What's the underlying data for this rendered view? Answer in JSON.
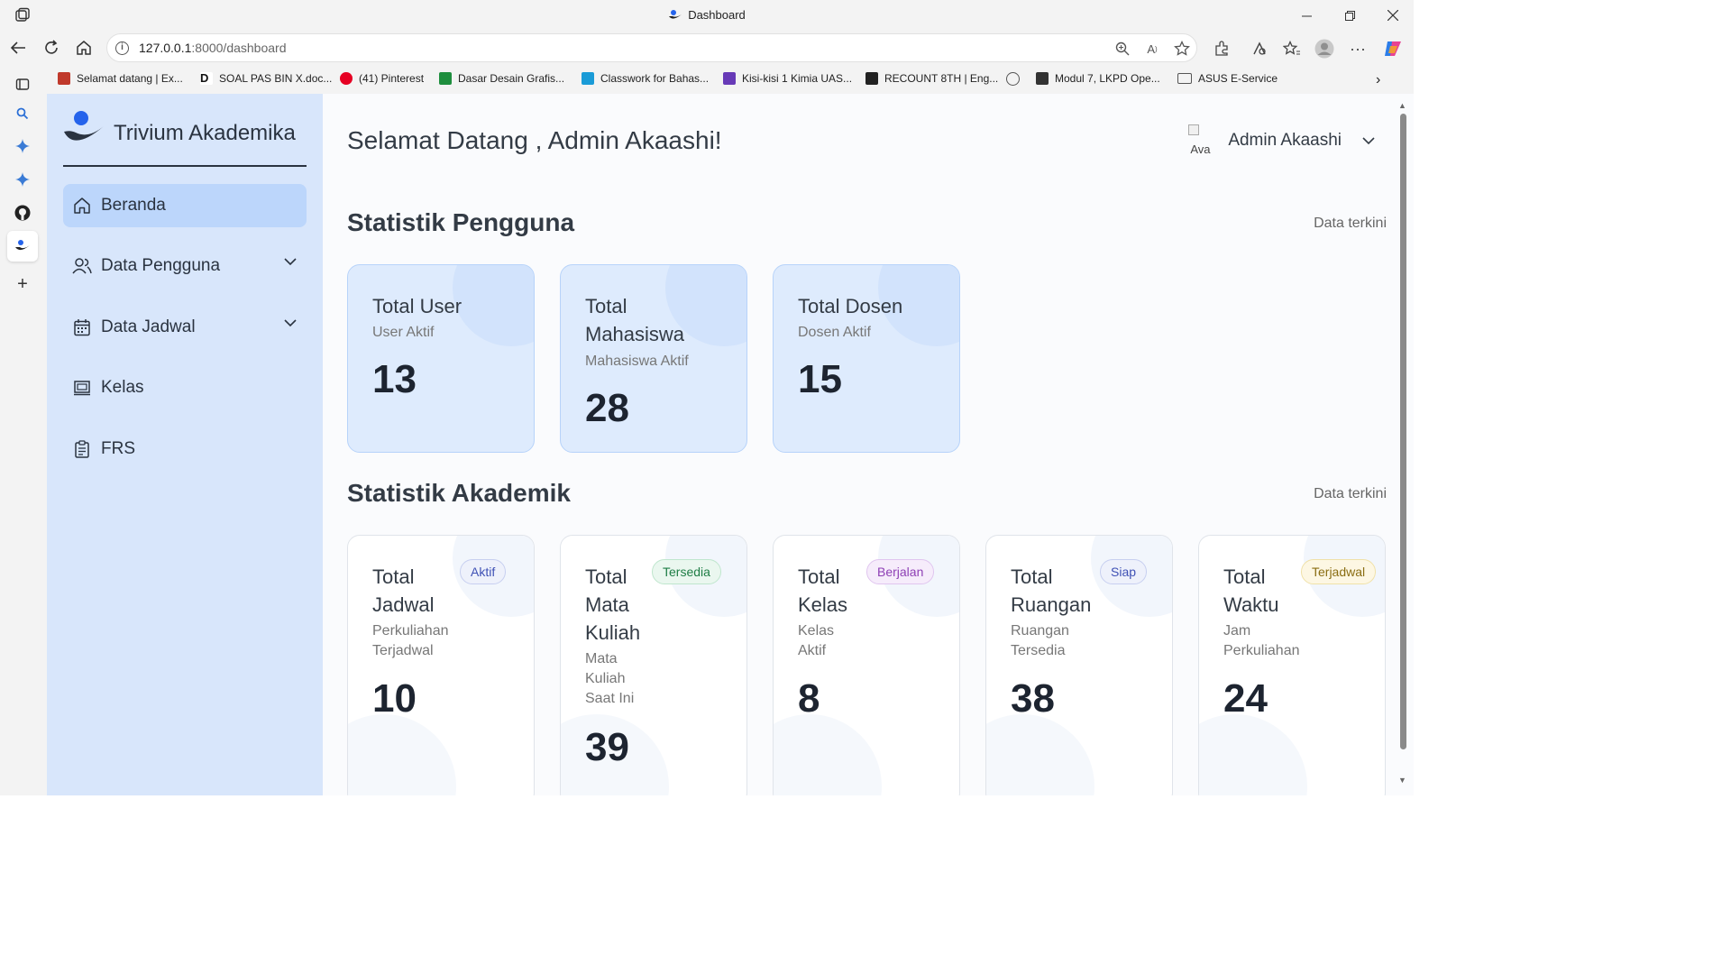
{
  "window": {
    "title": "Dashboard",
    "controls": [
      "minimize",
      "restore",
      "close"
    ]
  },
  "address": {
    "url_host": "127.0.0.1",
    "url_rest": ":8000/dashboard"
  },
  "bookmarks": [
    {
      "label": "Selamat datang | Ex...",
      "color": "#c0392b"
    },
    {
      "label": "SOAL PAS BIN X.doc...",
      "color": "#111111"
    },
    {
      "label": "(41) Pinterest",
      "color": "#e60023"
    },
    {
      "label": "Dasar Desain Grafis...",
      "color": "#1e8e3e"
    },
    {
      "label": "Classwork for Bahas...",
      "color": "#1a9bd7"
    },
    {
      "label": "Kisi-kisi 1 Kimia UAS...",
      "color": "#673ab7"
    },
    {
      "label": "RECOUNT 8TH | Eng...",
      "color": "#222222"
    },
    {
      "label": "",
      "color": "#555555"
    },
    {
      "label": "Modul 7, LKPD Ope...",
      "color": "#333333"
    },
    {
      "label": "ASUS E-Service",
      "color": "#555555"
    }
  ],
  "sidebar": {
    "brand": "Trivium Akademika",
    "items": [
      {
        "label": "Beranda",
        "icon": "home-icon",
        "active": true
      },
      {
        "label": "Data Pengguna",
        "icon": "users-icon",
        "dropdown": true
      },
      {
        "label": "Data Jadwal",
        "icon": "calendar-icon",
        "dropdown": true
      },
      {
        "label": "Kelas",
        "icon": "classroom-icon"
      },
      {
        "label": "FRS",
        "icon": "clipboard-icon"
      }
    ]
  },
  "header": {
    "welcome": "Selamat Datang , Admin Akaashi!",
    "user_name": "Admin Akaashi",
    "avatar_alt": "Ava"
  },
  "user_stats": {
    "title": "Statistik Pengguna",
    "note": "Data terkini",
    "cards": [
      {
        "title": "Total User",
        "subtitle": "User Aktif",
        "value": "13"
      },
      {
        "title": "Total Mahasiswa",
        "subtitle": "Mahasiswa Aktif",
        "value": "28"
      },
      {
        "title": "Total Dosen",
        "subtitle": "Dosen Aktif",
        "value": "15"
      }
    ]
  },
  "academic_stats": {
    "title": "Statistik Akademik",
    "note": "Data terkini",
    "cards": [
      {
        "title": "Total Jadwal",
        "subtitle": "Perkuliahan Terjadwal",
        "value": "10",
        "badge": "Aktif",
        "badge_color": "#3f51b5",
        "badge_bg": "#eef1fb",
        "badge_border": "#c7cff0"
      },
      {
        "title": "Total Mata Kuliah",
        "subtitle": "Mata Kuliah Saat Ini",
        "value": "39",
        "badge": "Tersedia",
        "badge_color": "#1e7d45",
        "badge_bg": "#eaf7ef",
        "badge_border": "#bfe6cd"
      },
      {
        "title": "Total Kelas",
        "subtitle": "Kelas Aktif",
        "value": "8",
        "badge": "Berjalan",
        "badge_color": "#8e3fb5",
        "badge_bg": "#f6ecfb",
        "badge_border": "#e0c5ef"
      },
      {
        "title": "Total Ruangan",
        "subtitle": "Ruangan Tersedia",
        "value": "38",
        "badge": "Siap",
        "badge_color": "#3f51b5",
        "badge_bg": "#eef1fb",
        "badge_border": "#c7cff0"
      },
      {
        "title": "Total Waktu",
        "subtitle": "Jam Perkuliahan",
        "value": "24",
        "badge": "Terjadwal",
        "badge_color": "#8a6d12",
        "badge_bg": "#fdf7e3",
        "badge_border": "#f0e1a8"
      }
    ]
  },
  "colors": {
    "sidebar_bg": "#d8e6fb",
    "active_item": "#bcd6fb",
    "brand_blue": "#2563eb",
    "text_dark": "#1d2430"
  }
}
